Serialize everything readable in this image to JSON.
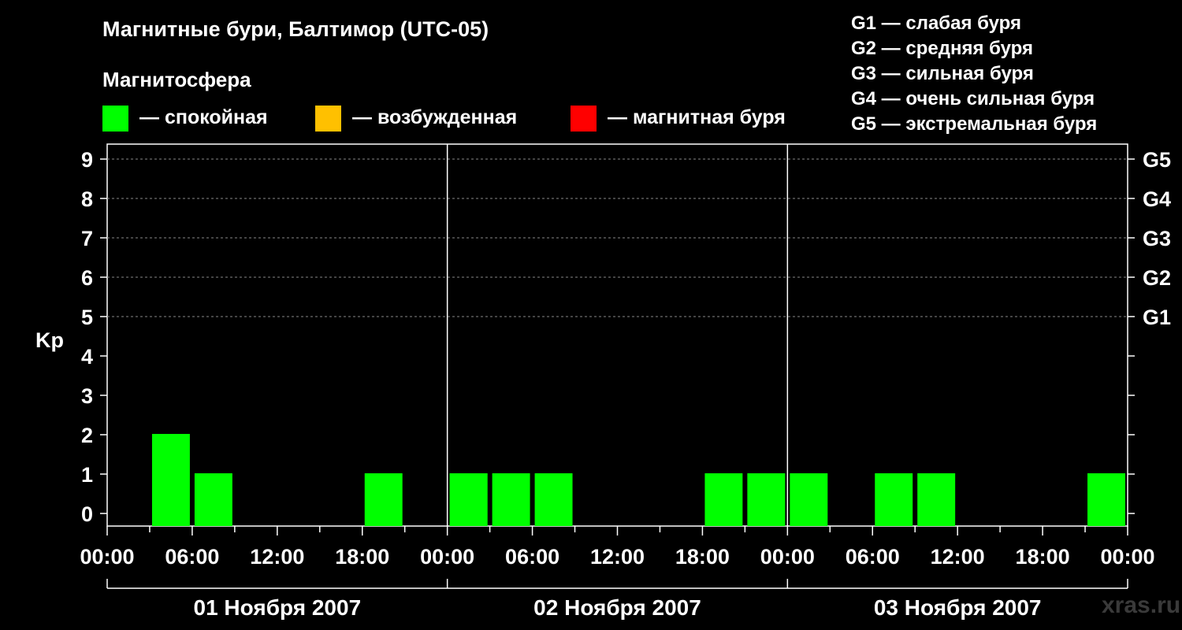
{
  "title": "Магнитные бури, Балтимор (UTC-05)",
  "magnetosphere_label": "Магнитосфера",
  "legend": [
    {
      "label": "— спокойная",
      "color": "#00ff00"
    },
    {
      "label": "— возбужденная",
      "color": "#ffc000"
    },
    {
      "label": "— магнитная буря",
      "color": "#ff0000"
    }
  ],
  "g_scale": [
    "G1 — слабая буря",
    "G2 — средняя буря",
    "G3 — сильная буря",
    "G4 — очень сильная буря",
    "G5 — экстремальная буря"
  ],
  "watermark": "xras.ru",
  "chart_data": {
    "type": "bar",
    "ylabel": "Kp",
    "ylim": [
      0,
      9
    ],
    "yticks": [
      0,
      1,
      2,
      3,
      4,
      5,
      6,
      7,
      8,
      9
    ],
    "right_labels": [
      {
        "kp": 5,
        "label": "G1"
      },
      {
        "kp": 6,
        "label": "G2"
      },
      {
        "kp": 7,
        "label": "G3"
      },
      {
        "kp": 8,
        "label": "G4"
      },
      {
        "kp": 9,
        "label": "G5"
      }
    ],
    "x_tick_labels": [
      "00:00",
      "06:00",
      "12:00",
      "18:00",
      "00:00",
      "06:00",
      "12:00",
      "18:00",
      "00:00",
      "06:00",
      "12:00",
      "18:00",
      "00:00"
    ],
    "days": [
      "01 Ноября 2007",
      "02 Ноября 2007",
      "03 Ноября 2007"
    ],
    "interval_hours": 3,
    "grid": "dashed horizontal lines at Kp 5–9, solid vertical lines at day boundaries",
    "kp_values": [
      [
        0,
        2,
        1,
        0,
        0,
        0,
        1,
        0,
        1
      ],
      [
        1,
        1,
        1,
        0,
        0,
        0,
        1,
        1,
        1
      ],
      [
        0,
        0,
        1,
        1,
        0,
        0,
        0,
        1,
        0
      ]
    ],
    "colors": {
      "quiet": "#00ff00",
      "active": "#ffc000",
      "storm": "#ff0000"
    }
  }
}
